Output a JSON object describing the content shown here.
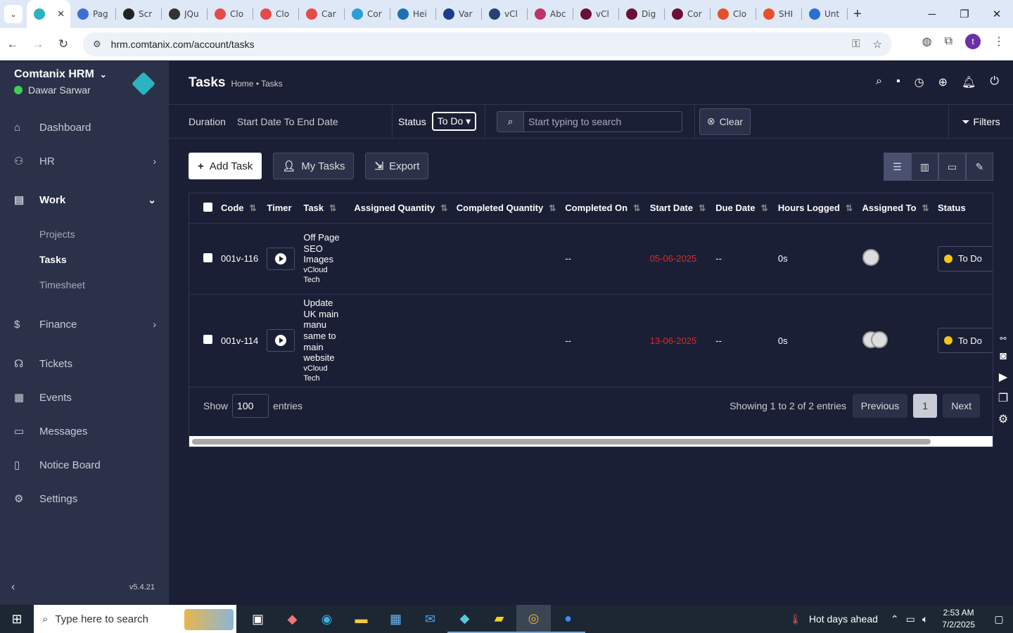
{
  "browser": {
    "tabs": [
      {
        "label": "",
        "icon": "comtanix-icon",
        "color": "#2bb3c0",
        "active": true
      },
      {
        "label": "Pag",
        "icon": "wave-icon",
        "color": "#3d6fd9"
      },
      {
        "label": "Scr",
        "icon": "gear-icon",
        "color": "#222222"
      },
      {
        "label": "JQu",
        "icon": "target-icon",
        "color": "#333333"
      },
      {
        "label": "Clo",
        "icon": "diamond-icon",
        "color": "#e54b4b"
      },
      {
        "label": "Clo",
        "icon": "diamond-icon",
        "color": "#e54b4b"
      },
      {
        "label": "Car",
        "icon": "diamond-icon",
        "color": "#e54b4b"
      },
      {
        "label": "Cor",
        "icon": "globe-icon",
        "color": "#2a9fd6"
      },
      {
        "label": "Hei",
        "icon": "scale-icon",
        "color": "#1f6fb5"
      },
      {
        "label": "Var",
        "icon": "x-icon",
        "color": "#1d3c8c"
      },
      {
        "label": "vCl",
        "icon": "check-icon",
        "color": "#24446f"
      },
      {
        "label": "Abc",
        "icon": "sparkle-icon",
        "color": "#c0306a"
      },
      {
        "label": "vCl",
        "icon": "v-icon",
        "color": "#6b1036"
      },
      {
        "label": "Dig",
        "icon": "v-icon",
        "color": "#6b1036"
      },
      {
        "label": "Cor",
        "icon": "v-icon",
        "color": "#6b1036"
      },
      {
        "label": "Clo",
        "icon": "slash-icon",
        "color": "#e5512b"
      },
      {
        "label": "SHI",
        "icon": "ring-icon",
        "color": "#e5512b"
      },
      {
        "label": "Unt",
        "icon": "doc-icon",
        "color": "#2a6fd6"
      }
    ],
    "url": "hrm.comtanix.com/account/tasks",
    "profile_initial": "t"
  },
  "sidebar": {
    "brand": "Comtanix HRM",
    "user": "Dawar Sarwar",
    "items": [
      {
        "label": "Dashboard",
        "icon": "house-icon"
      },
      {
        "label": "HR",
        "icon": "people-icon",
        "arrow": "›"
      },
      {
        "label": "Work",
        "icon": "briefcase-icon",
        "arrow": "⌄"
      },
      {
        "label": "Finance",
        "icon": "dollar-icon",
        "arrow": "›"
      },
      {
        "label": "Tickets",
        "icon": "headset-icon"
      },
      {
        "label": "Events",
        "icon": "calendar-icon"
      },
      {
        "label": "Messages",
        "icon": "chat-icon"
      },
      {
        "label": "Notice Board",
        "icon": "clipboard-icon"
      },
      {
        "label": "Settings",
        "icon": "gear-icon"
      }
    ],
    "work_sub": [
      "Projects",
      "Tasks",
      "Timesheet"
    ],
    "version": "v5.4.21"
  },
  "header": {
    "title": "Tasks",
    "breadcrumb": "Home • Tasks"
  },
  "filters": {
    "duration_label": "Duration",
    "duration_value": "Start Date To End Date",
    "status_label": "Status",
    "status_value": "To Do",
    "search_placeholder": "Start typing to search",
    "clear_label": "Clear",
    "filters_label": "Filters"
  },
  "actions": {
    "add_task": "Add Task",
    "my_tasks": "My Tasks",
    "export": "Export"
  },
  "table": {
    "columns": [
      "Code",
      "Timer",
      "Task",
      "Assigned Quantity",
      "Completed Quantity",
      "Completed On",
      "Start Date",
      "Due Date",
      "Hours Logged",
      "Assigned To",
      "Status"
    ],
    "rows": [
      {
        "code": "001v-116",
        "task": "Off Page SEO Images",
        "client": "vCloud Tech",
        "assigned_qty": "",
        "completed_qty": "",
        "completed_on": "--",
        "start_date": "05-06-2025",
        "due_date": "--",
        "hours": "0s",
        "status": "To Do"
      },
      {
        "code": "001v-114",
        "task": "Update UK main manu same to main website",
        "client": "vCloud Tech",
        "assigned_qty": "",
        "completed_qty": "",
        "completed_on": "--",
        "start_date": "13-06-2025",
        "due_date": "--",
        "hours": "0s",
        "status": "To Do"
      }
    ],
    "show_label": "Show",
    "page_length": "100",
    "entries_label": "entries",
    "info": "Showing 1 to 2 of 2 entries",
    "prev": "Previous",
    "page": "1",
    "next": "Next"
  },
  "taskbar": {
    "search_placeholder": "Type here to search",
    "weather": "Hot days ahead",
    "time": "2:53 AM",
    "date": "7/2/2025"
  },
  "colors": {
    "sidebar_bg": "#2b3149",
    "main_bg": "#1b1f35",
    "date_red": "#e0262a",
    "status_yellow": "#f5c518",
    "online_green": "#39d353"
  }
}
